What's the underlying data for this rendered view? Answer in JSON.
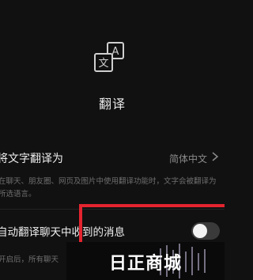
{
  "hero": {
    "title": "翻译",
    "icon": "translate-icon",
    "icon_glyph_back": "A",
    "icon_glyph_front": "文"
  },
  "translate_setting": {
    "label": "将文字翻译为",
    "value": "简体中文",
    "description": "在聊天、朋友圈、网页及图片中使用翻译功能时，文字会被翻译为所选语言。"
  },
  "auto_translate": {
    "label": "自动翻译聊天中收到的消息",
    "enabled": false,
    "description": "开启后，所有聊天"
  },
  "watermark": {
    "text": "日正商城"
  },
  "colors": {
    "background": "#111111",
    "highlight": "#e4242f"
  }
}
